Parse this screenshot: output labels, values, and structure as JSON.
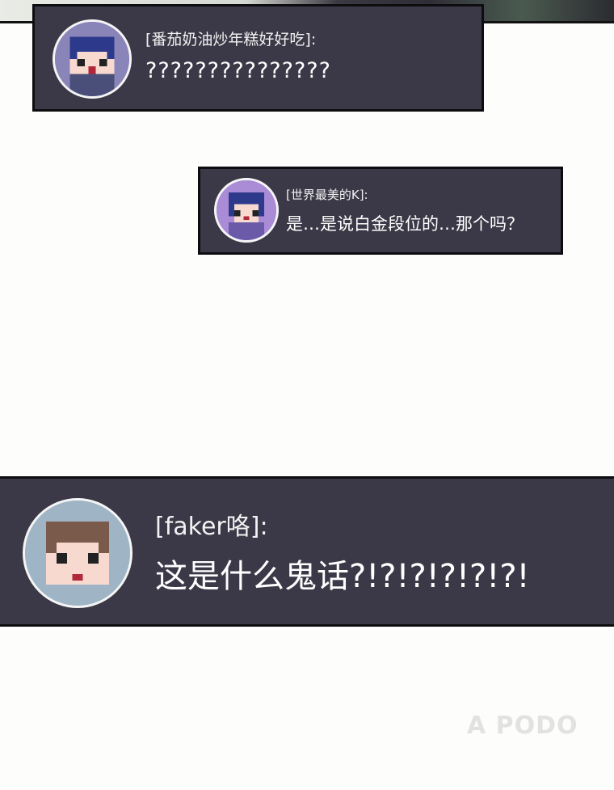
{
  "messages": [
    {
      "name": "[番茄奶油炒年糕好好吃]:",
      "text": "???????????????",
      "avatar_icon": "pixel-boy-avatar-icon",
      "avatar_bg": "#8a85b8"
    },
    {
      "name": "[世界最美的K]:",
      "text": "是…是说白金段位的…那个吗？",
      "avatar_icon": "pixel-girl-avatar-icon",
      "avatar_bg": "#a98bd6"
    },
    {
      "name": "[faker咯]:",
      "text": "这是什么鬼话?!?!?!?!?!?!",
      "avatar_icon": "pixel-brown-hair-avatar-icon",
      "avatar_bg": "#9fb5c6"
    }
  ],
  "watermark": "A PODO",
  "colors": {
    "bubble_bg": "#3b3947",
    "bubble_border": "#0d0d10",
    "page_bg": "#fdfdfb"
  }
}
